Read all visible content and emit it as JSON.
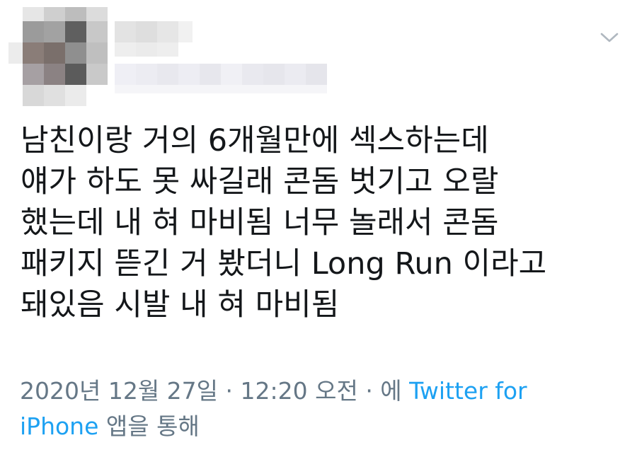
{
  "header": {
    "icon": "chevron-down-icon",
    "blurred_user_name": "",
    "colors": {
      "caret": "#b0b8c0"
    }
  },
  "tweet": {
    "text_lines": [
      "남친이랑 거의 6개월만에 섹스하는데",
      "얘가 하도 못 싸길래 콘돔 벗기고 오랄",
      "했는데 내 혀 마비됨 너무 놀래서 콘돔",
      "패키지 뜯긴 거 봤더니 Long Run 이라고",
      "돼있음 시발 내 혀 마비됨"
    ],
    "text_color": "#14171a"
  },
  "meta": {
    "date": "2020년 12월 27일",
    "separator": " · ",
    "time": "12:20 오전",
    "via_prefix": " · 에 ",
    "source_part1": "Twitter for",
    "source_part2": "iPhone",
    "via_suffix": " 앱을 통해",
    "colors": {
      "meta": "#657786",
      "link": "#1da1f2"
    }
  }
}
